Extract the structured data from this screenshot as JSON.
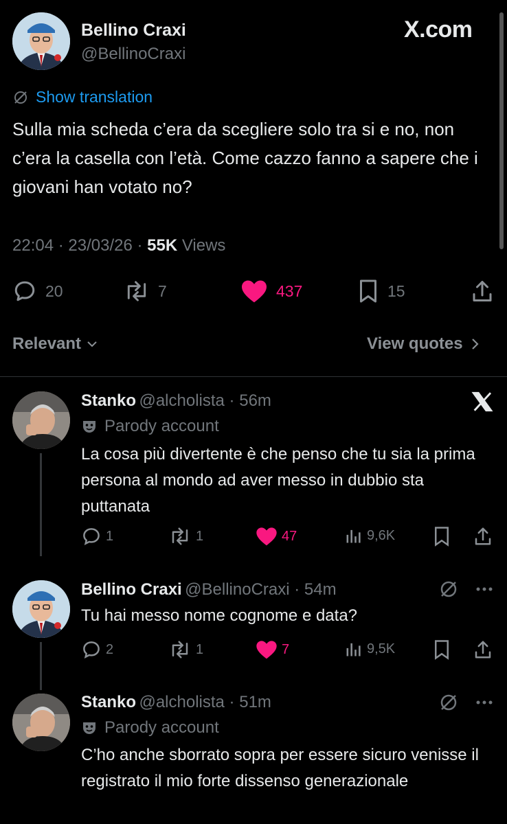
{
  "brand": "X.com",
  "main_tweet": {
    "name": "Bellino Craxi",
    "handle": "@BellinoCraxi",
    "translate_label": "Show translation",
    "text": "Sulla mia scheda c’era da scegliere solo tra si e no, non c’era la casella con l’età. Come cazzo fanno a sapere che i giovani han votato no?",
    "time": "22:04",
    "date": "23/03/26",
    "views_count": "55K",
    "views_label": "Views",
    "replies": "20",
    "reposts": "7",
    "likes": "437",
    "bookmarks": "15"
  },
  "filters": {
    "relevant_label": "Relevant",
    "view_quotes_label": "View quotes"
  },
  "replies": [
    {
      "name": "Stanko",
      "handle": "@alcholista",
      "time": "56m",
      "parody_label": "Parody account",
      "text": "La cosa più divertente è che penso che tu sia la prima persona al mondo ad aver messo in dubbio sta puttanata",
      "replies": "1",
      "reposts": "1",
      "likes": "47",
      "views": "9,6K"
    },
    {
      "name": "Bellino Craxi",
      "handle": "@BellinoCraxi",
      "time": "54m",
      "text": "Tu hai messo nome cognome e data?",
      "replies": "2",
      "reposts": "1",
      "likes": "7",
      "views": "9,5K"
    },
    {
      "name": "Stanko",
      "handle": "@alcholista",
      "time": "51m",
      "parody_label": "Parody account",
      "text": "C’ho anche sborrato sopra per essere sicuro venisse il registrato il mio forte dissenso generazionale"
    }
  ],
  "colors": {
    "background": "#000000",
    "text": "#e7e9ea",
    "muted": "#71767b",
    "link": "#1d9bf0",
    "like": "#f91880"
  },
  "icons": [
    "translate-icon",
    "reply-icon",
    "repost-icon",
    "heart-icon",
    "bookmark-icon",
    "share-icon",
    "chevron-down-icon",
    "chevron-right-icon",
    "x-logo-icon",
    "mask-icon",
    "views-icon",
    "more-icon"
  ]
}
